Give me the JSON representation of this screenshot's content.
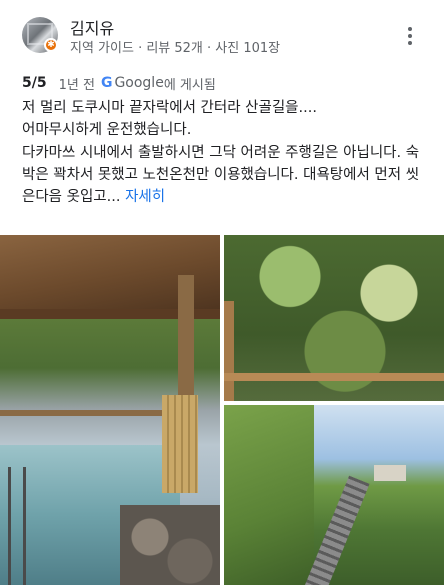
{
  "reviewer": {
    "name": "김지유",
    "meta": "지역 가이드 · 리뷰 52개 · 사진 101장",
    "badge_icon": "local-guide-star-icon",
    "badge_color": "#e8710a"
  },
  "rating": {
    "score": "5/5",
    "time": "1년 전",
    "source_g": "G",
    "source_name": "Google",
    "posted_suffix": "에 게시됨"
  },
  "review": {
    "line1": "저 멀리 도쿠시마 끝자락에서 간터라 산골길을....",
    "line2": "어마무시하게 운전했습니다.",
    "body": "다카마쓰 시내에서 출발하시면 그닥 어려운 주행길은 아닙니다. 숙박은 꽉차서 못했고 노천온천만 이용했습니다. 대욕탕에서 먼저 씻은다음  옷입고... ",
    "more_label": "자세히"
  },
  "photos": [
    {
      "name": "photo-outdoor-hot-spring"
    },
    {
      "name": "photo-mountain-cliff"
    },
    {
      "name": "photo-cable-car-track"
    }
  ],
  "colors": {
    "link": "#1a73e8",
    "text": "#202124",
    "secondary": "#5f6368"
  }
}
